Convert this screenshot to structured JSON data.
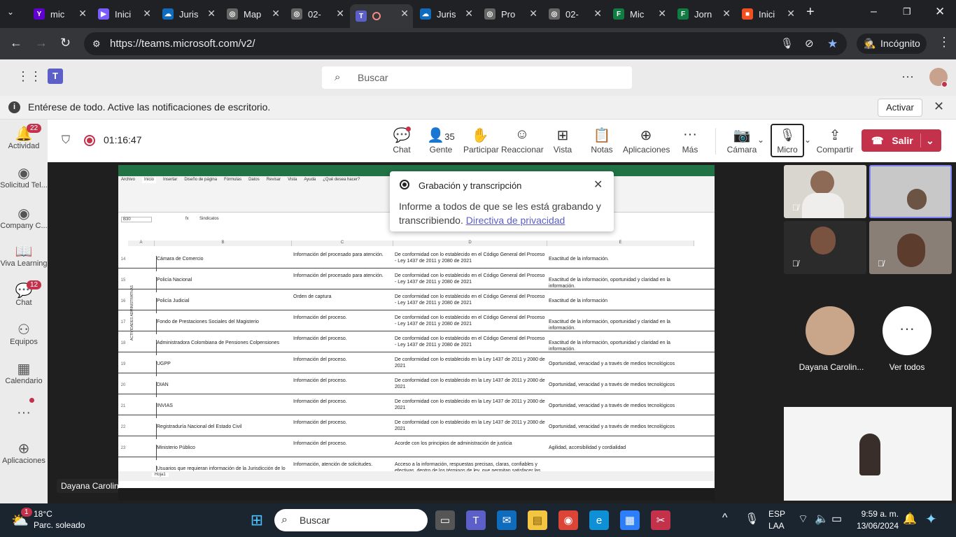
{
  "browser": {
    "tabs": [
      {
        "label": "mic",
        "fav": "Y",
        "color": "#6001d2"
      },
      {
        "label": "Inici",
        "fav": "▶",
        "color": "#7b5cff"
      },
      {
        "label": "Juris",
        "fav": "☁",
        "color": "#0f6cbd"
      },
      {
        "label": "Map",
        "fav": "◎",
        "color": "#666"
      },
      {
        "label": "02-",
        "fav": "◎",
        "color": "#666"
      },
      {
        "label": "",
        "fav": "T",
        "color": "#5b5fc7"
      },
      {
        "label": "Juris",
        "fav": "☁",
        "color": "#0f6cbd"
      },
      {
        "label": "Pro",
        "fav": "◎",
        "color": "#666"
      },
      {
        "label": "02-",
        "fav": "◎",
        "color": "#666"
      },
      {
        "label": "Mic",
        "fav": "F",
        "color": "#107c41"
      },
      {
        "label": "Jorn",
        "fav": "F",
        "color": "#107c41"
      },
      {
        "label": "Inici",
        "fav": "■",
        "color": "#f25022"
      }
    ],
    "url": "https://teams.microsoft.com/v2/",
    "incognito": "Incógnito"
  },
  "teams": {
    "search_placeholder": "Buscar",
    "banner_text": "Entérese de todo. Active las notificaciones de escritorio.",
    "banner_button": "Activar",
    "rail": [
      {
        "label": "Actividad",
        "icon": "bell-icon",
        "badge": "22"
      },
      {
        "label": "Solicitud Tel...",
        "icon": "app-icon",
        "badge": ""
      },
      {
        "label": "Company C...",
        "icon": "app-icon",
        "badge": ""
      },
      {
        "label": "Viva Learning",
        "icon": "book-icon",
        "badge": ""
      },
      {
        "label": "Chat",
        "icon": "chat-icon",
        "badge": "12"
      },
      {
        "label": "Equipos",
        "icon": "teams-icon",
        "badge": ""
      },
      {
        "label": "Calendario",
        "icon": "calendar-icon",
        "badge": ""
      },
      {
        "label": "",
        "icon": "more-icon",
        "badge": ""
      },
      {
        "label": "Aplicaciones",
        "icon": "apps-icon",
        "badge": ""
      }
    ],
    "timer": "01:16:47",
    "toolbar": {
      "chat": "Chat",
      "people": "Gente",
      "people_count": "35",
      "raise": "Participar",
      "react": "Reaccionar",
      "view": "Vista",
      "notes": "Notas",
      "apps": "Aplicaciones",
      "more": "Más",
      "camera": "Cámara",
      "mic": "Micro",
      "share": "Compartir",
      "leave": "Salir"
    },
    "popup": {
      "title": "Grabación y transcripción",
      "body": "Informe a todos de que se les está grabando y transcribiendo.",
      "link": "Directiva de privacidad"
    },
    "participants": {
      "named": "Dayana Carolin...",
      "see_all": "Ver todos",
      "presenter": "Dayana Carolina Saltaren Beltran"
    }
  },
  "excel": {
    "menu": [
      "Archivo",
      "Inicio",
      "Insertar",
      "Diseño de página",
      "Fórmulas",
      "Datos",
      "Revisar",
      "Vista",
      "Ayuda",
      "¿Qué desea hacer?"
    ],
    "namebox": "B30",
    "formula": "Sindicatos",
    "cols": [
      "A",
      "B",
      "C",
      "D",
      "E"
    ],
    "side_label": "ACTIVIDADES ADMINISTRATIVAS",
    "rows": [
      {
        "n": "14",
        "b": "Cámara de Comercio",
        "c": "Información del procesado para atención.",
        "d": "De conformidad con lo establecido en el Código General del Proceso - Ley 1437 de 2011 y 2080 de 2021",
        "e": "Exactitud de la información."
      },
      {
        "n": "15",
        "b": "Policía Nacional",
        "c": "Información del procesado para atención.",
        "d": "De conformidad con lo establecido en el Código General del Proceso - Ley 1437 de 2011 y 2080 de 2021",
        "e": "Exactitud de la información, oportunidad y claridad en la información."
      },
      {
        "n": "16",
        "b": "Policía Judicial",
        "c": "Orden de captura",
        "d": "De conformidad con lo establecido en el Código General del Proceso - Ley 1437 de 2011 y 2080 de 2021",
        "e": "Exactitud de la información"
      },
      {
        "n": "17",
        "b": "Fondo de Prestaciones Sociales del Magisterio",
        "c": "Información del proceso.",
        "d": "De conformidad con lo establecido en el Código General del Proceso - Ley 1437 de 2011 y 2080 de 2021",
        "e": "Exactitud de la información, oportunidad y claridad en la información."
      },
      {
        "n": "18",
        "b": "Administradora Colombiana de Pensiones Colpensiones",
        "c": "Información del proceso.",
        "d": "De conformidad con lo establecido en el Código General del Proceso - Ley 1437 de 2011 y 2080 de 2021",
        "e": "Exactitud de la información, oportunidad y claridad en la información."
      },
      {
        "n": "19",
        "b": "UGPP",
        "c": "Información del proceso.",
        "d": "De conformidad con lo establecido en la Ley 1437 de 2011 y 2080 de 2021",
        "e": "Oportunidad, veracidad y a través de medios tecnológicos"
      },
      {
        "n": "20",
        "b": "DIAN",
        "c": "Información del proceso.",
        "d": "De conformidad con lo establecido en la Ley 1437 de 2011 y 2080 de 2021",
        "e": "Oportunidad, veracidad y a través de medios tecnológicos"
      },
      {
        "n": "21",
        "b": "INVIAS",
        "c": "Información del proceso.",
        "d": "De conformidad con lo establecido en la Ley 1437 de 2011 y 2080 de 2021",
        "e": "Oportunidad, veracidad y a través de medios tecnológicos"
      },
      {
        "n": "22",
        "b": "Registraduría Nacional del Estado Civil",
        "c": "Información del proceso.",
        "d": "De conformidad con lo establecido en la Ley 1437 de 2011 y 2080 de 2021",
        "e": "Oportunidad, veracidad y a través de medios tecnológicos"
      },
      {
        "n": "23",
        "b": "Ministerio Público",
        "c": "Información del proceso.",
        "d": "Acorde con los principios de administración de justicia",
        "e": "Agilidad, accesibilidad y cordialidad"
      },
      {
        "n": "",
        "b": "Usuarios que requieran información de la Jurisdicción de lo Contencioso Administrativo",
        "c": "Información, atención de solicitudes.",
        "d": "Acceso a la información, respuestas precisas, claras, confiables y efectivas, dentro de los términos de ley, que permitan satisfacer las",
        "e": ""
      }
    ],
    "sheet_tab": "Hoja1"
  },
  "taskbar": {
    "weather_temp": "18°C",
    "weather_desc": "Parc. soleado",
    "weather_badge": "1",
    "search": "Buscar",
    "lang1": "ESP",
    "lang2": "LAA",
    "time": "9:59 a. m.",
    "date": "13/06/2024"
  }
}
